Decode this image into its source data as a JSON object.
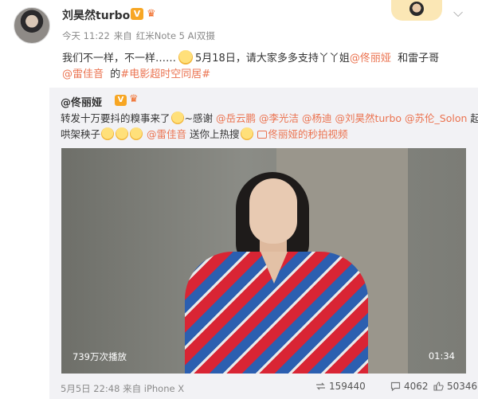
{
  "post": {
    "username": "刘昊然turbo",
    "vip_badge": "V",
    "level_icon": "crown-icon",
    "meta": {
      "time": "今天 11:22",
      "source_prefix": "来自",
      "source": "红米Note 5 AI双摄"
    },
    "text": {
      "line1_a": "我们不一样，不一样……",
      "line1_b": "5月18日，请大家多多支持丫丫姐",
      "mention1": "@佟丽娅",
      "line1_c": "和雷子哥",
      "mention2": "@雷佳音",
      "line2_b": "的",
      "topic": "#电影超时空同居#"
    }
  },
  "repost": {
    "username": "@佟丽娅",
    "vip_badge": "V",
    "line1_a": "转发十万要抖的糗事来了",
    "line1_b": "~感谢",
    "mentions": [
      "@岳云鹏",
      "@李光洁",
      "@杨迪",
      "@刘昊然turbo",
      "@苏伦_Solon"
    ],
    "line1_end": "起",
    "line2_a": "哄架秧子",
    "mention_last": "@雷佳音",
    "line2_b": "送你上热搜",
    "video_link": "佟丽娅的秒拍视频",
    "video": {
      "views": "739万次播放",
      "duration": "01:34"
    },
    "meta": {
      "time": "5月5日 22:48",
      "source_prefix": "来自",
      "source": "iPhone X"
    },
    "stats": {
      "reposts": "159440",
      "comments": "4062",
      "likes": "50346"
    }
  },
  "colors": {
    "link": "#eb7350",
    "repost_bg": "#f2f2f5",
    "vip": "#f7a623"
  }
}
